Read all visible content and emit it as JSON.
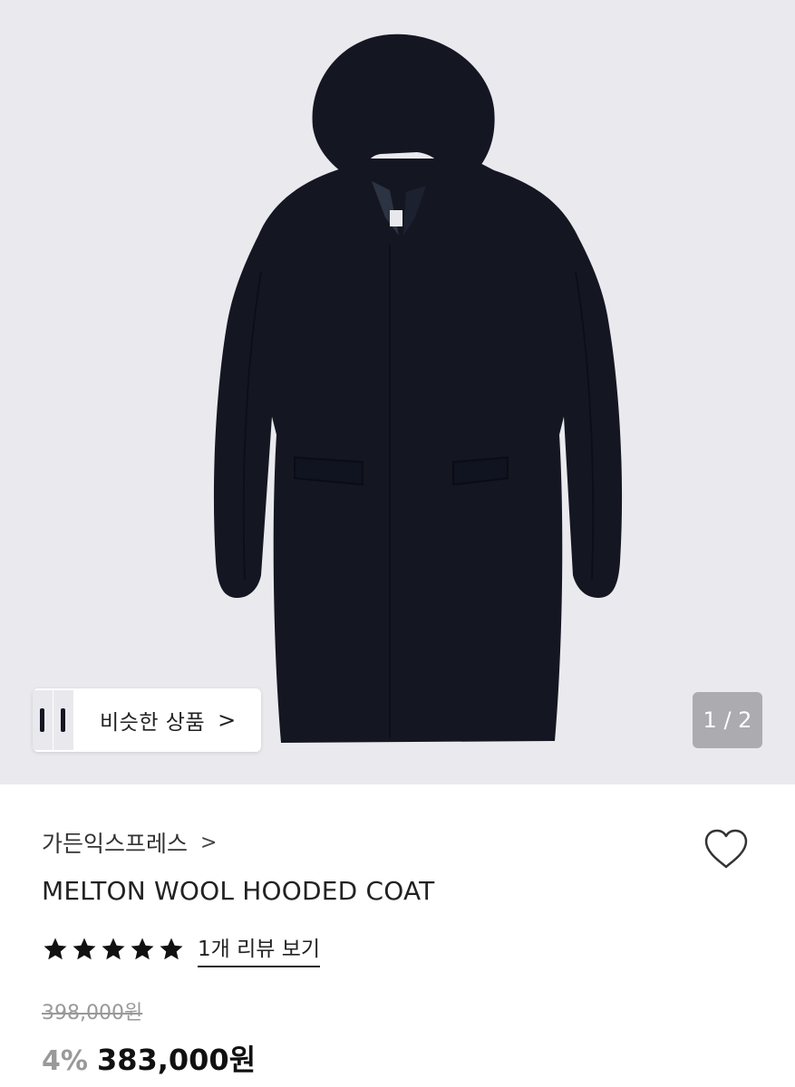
{
  "hero": {
    "image_subject": "coat-image",
    "similar_products_label": "비슷한 상품",
    "similar_products_chevron": ">",
    "page_indicator": "1 / 2"
  },
  "product": {
    "brand": "가든익스프레스",
    "brand_chevron": ">",
    "name": "MELTON WOOL HOODED COAT",
    "rating_stars": 5,
    "review_link": "1개 리뷰 보기",
    "original_price": "398,000원",
    "discount": "4%",
    "price": "383,000원"
  },
  "colors": {
    "hero_bg": "#eae9ee",
    "coat": "#141722",
    "muted_text": "#999999"
  },
  "icons": {
    "wishlist": "heart-outline-icon",
    "star": "star-filled-icon"
  }
}
